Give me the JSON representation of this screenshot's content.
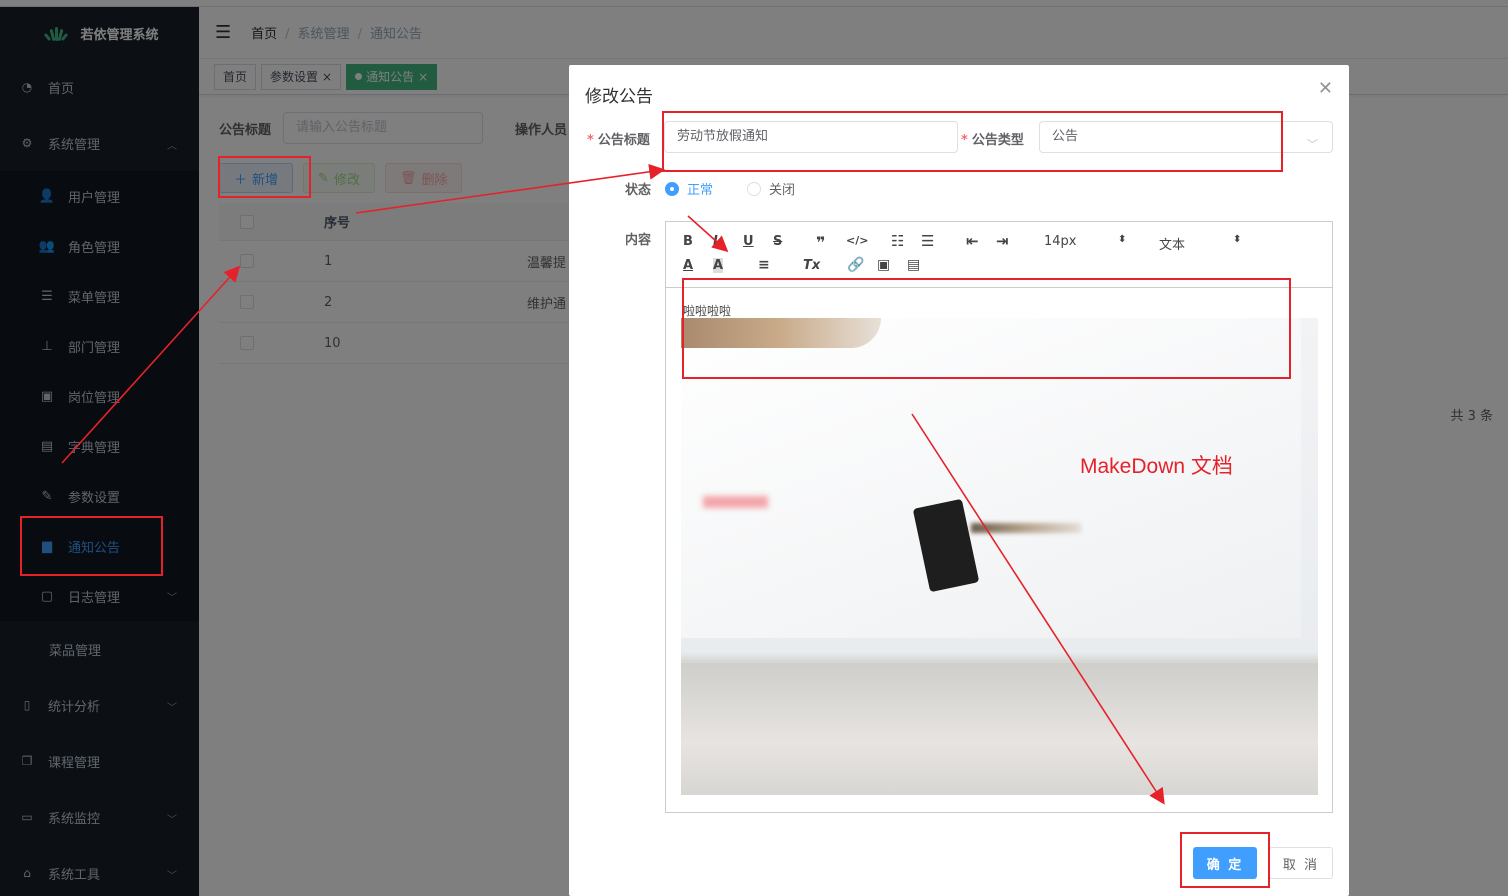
{
  "sidebar": {
    "logo_text": "若依管理系统",
    "home": "首页",
    "system": "系统管理",
    "system_children": [
      {
        "label": "用户管理",
        "icon": "user-icon"
      },
      {
        "label": "角色管理",
        "icon": "peoples-icon"
      },
      {
        "label": "菜单管理",
        "icon": "tree-table-icon"
      },
      {
        "label": "部门管理",
        "icon": "tree-icon"
      },
      {
        "label": "岗位管理",
        "icon": "post-icon"
      },
      {
        "label": "字典管理",
        "icon": "dict-icon"
      },
      {
        "label": "参数设置",
        "icon": "edit-icon"
      },
      {
        "label": "通知公告",
        "icon": "message-icon"
      },
      {
        "label": "日志管理",
        "icon": "log-icon"
      }
    ],
    "dish": "菜品管理",
    "stats": "统计分析",
    "course": "课程管理",
    "monitor": "系统监控",
    "tool": "系统工具"
  },
  "navbar": {
    "breadcrumb": [
      "首页",
      "系统管理",
      "通知公告"
    ]
  },
  "tags": [
    {
      "label": "首页"
    },
    {
      "label": "参数设置"
    },
    {
      "label": "通知公告"
    }
  ],
  "search": {
    "title_label": "公告标题",
    "title_placeholder": "请输入公告标题",
    "operator_label": "操作人员"
  },
  "toolbar": {
    "add": "新增",
    "edit": "修改",
    "delete": "删除"
  },
  "table": {
    "col_no": "序号",
    "rows": [
      {
        "no": "1",
        "title": "温馨提"
      },
      {
        "no": "2",
        "title": "维护通"
      },
      {
        "no": "10",
        "title": ""
      }
    ],
    "total": "共 3 条"
  },
  "dialog": {
    "title": "修改公告",
    "title_label": "公告标题",
    "title_value": "劳动节放假通知",
    "type_label": "公告类型",
    "type_value": "公告",
    "status_label": "状态",
    "status_on": "正常",
    "status_off": "关闭",
    "content_label": "内容",
    "editor_size": "14px",
    "editor_format": "文本",
    "content_text": "啦啦啦啦",
    "ok": "确 定",
    "cancel": "取 消"
  },
  "annotation": {
    "text": "MakeDown 文档",
    "color": "#e5222a"
  },
  "colors": {
    "primary": "#409eff",
    "sidebar_bg": "#18212b",
    "tag_active": "#42b983"
  }
}
